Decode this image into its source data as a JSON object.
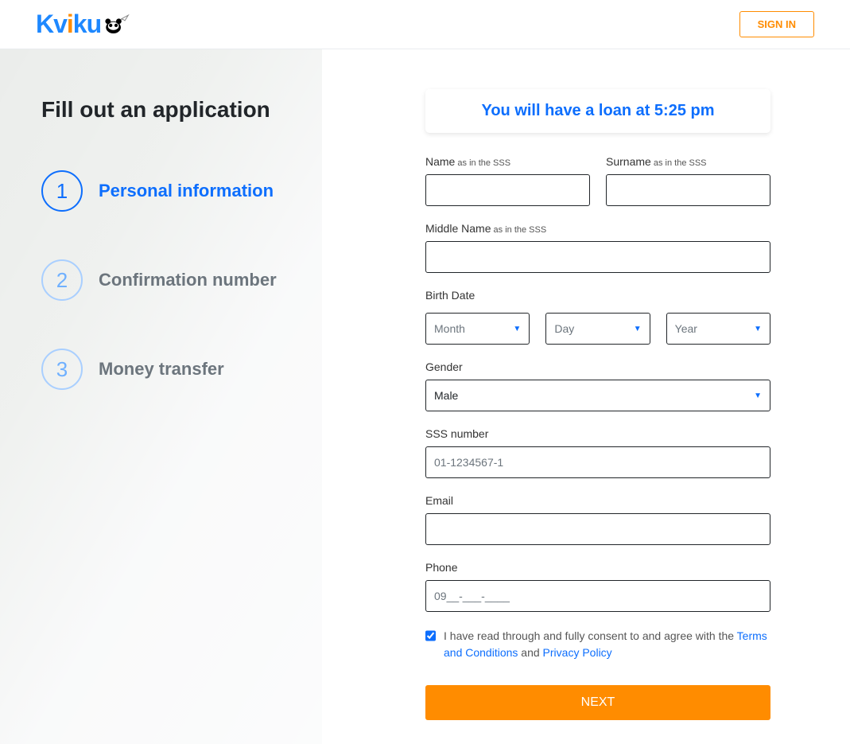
{
  "header": {
    "logo_text": "Kviku",
    "signin": "SIGN IN"
  },
  "left": {
    "title": "Fill out an application",
    "steps": [
      {
        "num": "1",
        "label": "Personal information",
        "active": true
      },
      {
        "num": "2",
        "label": "Confirmation number",
        "active": false
      },
      {
        "num": "3",
        "label": "Money transfer",
        "active": false
      }
    ]
  },
  "banner": "You will have a loan at 5:25 pm",
  "form": {
    "name_label": "Name",
    "name_hint": " as in the SSS",
    "surname_label": "Surname",
    "surname_hint": " as in the SSS",
    "middle_label": "Middle Name",
    "middle_hint": " as in the SSS",
    "birth_label": "Birth Date",
    "month_ph": "Month",
    "day_ph": "Day",
    "year_ph": "Year",
    "gender_label": "Gender",
    "gender_value": "Male",
    "sss_label": "SSS number",
    "sss_ph": "01-1234567-1",
    "email_label": "Email",
    "phone_label": "Phone",
    "phone_ph": "09__-___-____",
    "consent_prefix": "I have read through and fully consent to and agree with the ",
    "consent_terms": "Terms and Conditions",
    "consent_and": " and ",
    "consent_privacy": "Privacy Policy",
    "next": "NEXT"
  }
}
